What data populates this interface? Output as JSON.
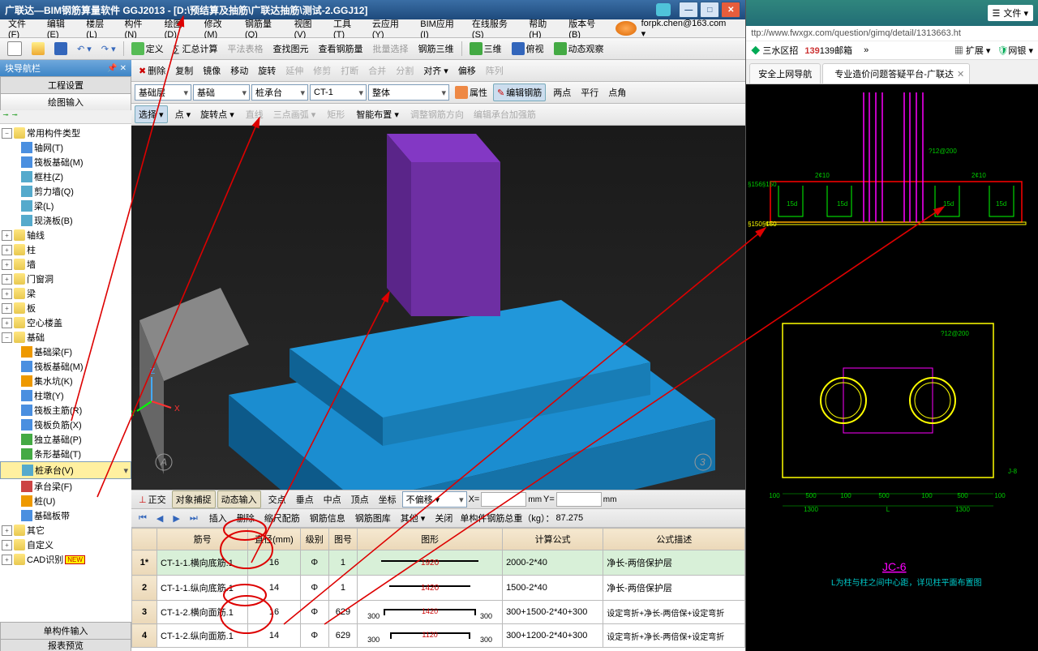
{
  "title": "广联达—BIM钢筋算量软件 GGJ2013 - [D:\\预结算及抽筋\\广联达抽筋\\测试-2.GGJ12]",
  "menu": [
    "文件(F)",
    "编辑(E)",
    "楼层(L)",
    "构件(N)",
    "绘图(D)",
    "修改(M)",
    "钢筋量(Q)",
    "视图(V)",
    "工具(T)",
    "云应用(Y)",
    "BIM应用(I)",
    "在线服务(S)",
    "帮助(H)",
    "版本号(B)"
  ],
  "user": "forpk.chen@163.com ▾",
  "tb1": {
    "a": "定义",
    "b": "∑ 汇总计算",
    "c": "平法表格",
    "d": "查找图元",
    "e": "查看钢筋量",
    "f": "批量选择",
    "g": "钢筋三维",
    "h": "三维",
    "i": "俯视",
    "j": "动态观察"
  },
  "tb_edit": {
    "del": "删除",
    "copy": "复制",
    "mirror": "镜像",
    "move": "移动",
    "rot": "旋转",
    "ext": "延伸",
    "trim": "修剪",
    "brk": "打断",
    "join": "合并",
    "spl": "分割",
    "align": "对齐 ▾",
    "off": "偏移",
    "arr": "阵列"
  },
  "tb_layer": {
    "lvl": "基础层",
    "cat": "基础",
    "comp": "桩承台",
    "ct": "CT-1",
    "scope": "整体",
    "attr": "属性",
    "editbar": "编辑钢筋"
  },
  "tb_draw": {
    "sel": "选择 ▾",
    "pt": "点 ▾",
    "rotpt": "旋转点 ▾",
    "line": "直线",
    "arc": "三点画弧 ▾",
    "rect": "矩形",
    "smart": "智能布置 ▾",
    "adjdir": "调整钢筋方向",
    "editpt": "编辑承台加强筋",
    "tp": "两点",
    "par": "平行",
    "ptang": "点角"
  },
  "nav": {
    "title": "块导航栏",
    "tab1": "工程设置",
    "tab2": "绘图输入",
    "bottom1": "单构件输入",
    "bottom2": "报表预览"
  },
  "tree": {
    "root": "常用构件类型",
    "kids": [
      "轴网(T)",
      "筏板基础(M)",
      "框柱(Z)",
      "剪力墙(Q)",
      "梁(L)",
      "现浇板(B)"
    ],
    "top": [
      "轴线",
      "柱",
      "墙",
      "门窗洞",
      "梁",
      "板",
      "空心楼盖"
    ],
    "jc": "基础",
    "jckids": [
      "基础梁(F)",
      "筏板基础(M)",
      "集水坑(K)",
      "柱墩(Y)",
      "筏板主筋(R)",
      "筏板负筋(X)",
      "独立基础(P)",
      "条形基础(T)",
      "桩承台(V)",
      "承台梁(F)",
      "桩(U)",
      "基础板带"
    ],
    "other": [
      "其它",
      "自定义",
      "CAD识别"
    ]
  },
  "snap": {
    "o": "正交",
    "s": "对象捕捉",
    "d": "动态输入",
    "jd": "交点",
    "cz": "垂点",
    "mid": "中点",
    "vt": "顶点",
    "zb": "坐标",
    "nooff": "不偏移 ▾",
    "x": "X=",
    "y": "Y="
  },
  "row": {
    "ins": "插入",
    "del": "删除",
    "scale": "缩尺配筋",
    "info": "钢筋信息",
    "lib": "钢筋图库",
    "other": "其他 ▾",
    "close": "关闭",
    "total": "单构件钢筋总重（kg）：",
    "val": "87.275"
  },
  "cols": [
    "",
    "筋号",
    "直径(mm)",
    "级别",
    "图号",
    "图形",
    "计算公式",
    "公式描述"
  ],
  "rows": [
    {
      "n": "1*",
      "id": "CT-1-1.横向底筋.1",
      "d": "16",
      "lv": "Φ",
      "pn": "1",
      "shape": "1920",
      "calc": "2000-2*40",
      "desc": "净长-两倍保护层"
    },
    {
      "n": "2",
      "id": "CT-1-1.纵向底筋.1",
      "d": "14",
      "lv": "Φ",
      "pn": "1",
      "shape": "1420",
      "calc": "1500-2*40",
      "desc": "净长-两倍保护层"
    },
    {
      "n": "3",
      "id": "CT-1-2.横向面筋.1",
      "d": "16",
      "lv": "Φ",
      "pn": "629",
      "shape": "300  1420  300",
      "calc": "300+1500-2*40+300",
      "desc": "设定弯折+净长-两倍保+设定弯折"
    },
    {
      "n": "4",
      "id": "CT-1-2.纵向面筋.1",
      "d": "14",
      "lv": "Φ",
      "pn": "629",
      "shape": "300  1120  300",
      "calc": "300+1200-2*40+300",
      "desc": "设定弯折+净长-两倍保+设定弯折"
    }
  ],
  "browser": {
    "filesMenu": "文件 ▾",
    "url": "ttp://www.fwxgx.com/question/gimq/detail/1313663.ht",
    "book": [
      "三水区招",
      "139邮箱"
    ],
    "ext": "扩展 ▾",
    "bank": "网银 ▾",
    "tabs": [
      "安全上网导航",
      "专业造价问题答疑平台-广联达"
    ],
    "jc": "JC-6",
    "note": "L为柱与柱之间中心距，详见柱平面布置图",
    "dims": [
      "100",
      "500",
      "100",
      "500",
      "100",
      "500",
      "100"
    ],
    "dimsB": [
      "1300",
      "L",
      "1300"
    ],
    "labels": [
      "§156§150",
      "15d",
      "15d",
      "15d",
      "15d",
      "2¢10",
      "2¢10",
      "?12@200",
      "?12@200"
    ]
  }
}
